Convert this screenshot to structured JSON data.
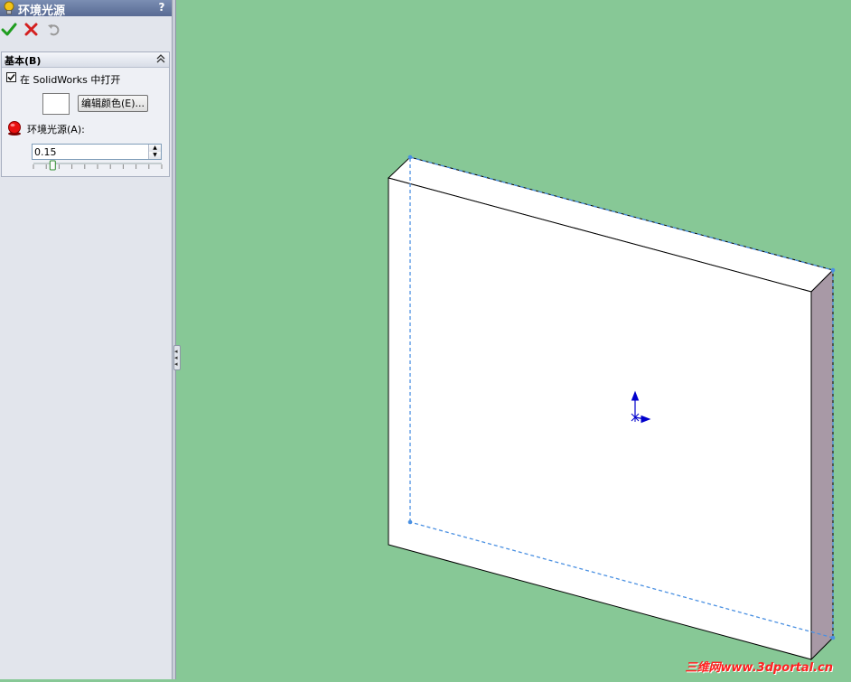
{
  "panel": {
    "title": "环境光源",
    "help": "?",
    "actions": [
      "confirm-icon",
      "cancel-icon",
      "undo-icon"
    ],
    "group": {
      "title": "基本(B)",
      "checkbox_label": "在 SolidWorks 中打开",
      "checkbox_checked": true,
      "edit_color_label": "编辑颜色(E)...",
      "swatch_color": "#ffffff",
      "ambient_label": "环境光源(A):",
      "ambient_value": "0.15",
      "ambient_level": 0.15
    }
  },
  "viewport": {
    "background": "#87c896",
    "watermark": "三维网www.3dportal.cn"
  },
  "colors": {
    "accent_title": "#586a93",
    "confirm": "#1f9d1f",
    "cancel": "#d42020",
    "bulb": "#f2c318",
    "part_face": "#ffffff",
    "part_side": "#a899a6",
    "sketch_dashed": "#4a90e2",
    "origin_axes": "#0000cc"
  }
}
